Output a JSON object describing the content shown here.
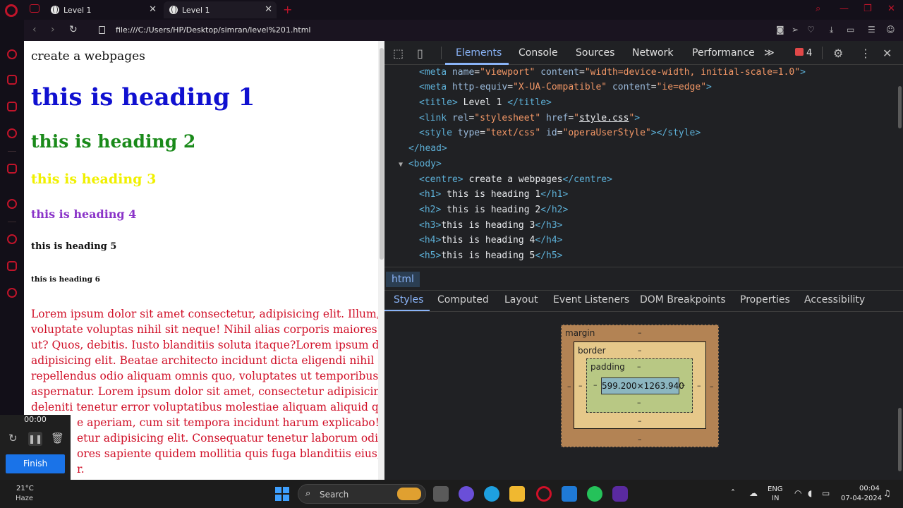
{
  "browser": {
    "tabs": [
      {
        "title": "Level 1",
        "active": false
      },
      {
        "title": "Level 1",
        "active": true
      }
    ],
    "url": "file:///C:/Users/HP/Desktop/simran/level%201.html"
  },
  "page": {
    "centre": "create a webpages",
    "h1": "this is heading 1",
    "h2": "this is heading 2",
    "h3": "this is heading 3",
    "h4": "this is heading 4",
    "h5": "this is heading 5",
    "h6": "this is heading 6",
    "lorem_lines": [
      "Lorem ipsum dolor sit amet consectetur, adipisicing elit. Illum, c",
      "voluptate voluptas nihil sit neque! Nihil alias corporis maiores v",
      "ut? Quos, debitis. Iusto blanditiis soluta itaque?Lorem ipsum dol",
      "adipisicing elit. Beatae architecto incidunt dicta eligendi nihil eo",
      "repellendus odio aliquam omnis quo, voluptates ut temporibus n",
      "aspernatur. Lorem ipsum dolor sit amet, consectetur adipisicing",
      "deleniti tenetur error voluptatibus molestiae aliquam aliquid qui",
      "e aperiam, cum sit tempora incidunt harum explicabo! Lo",
      "etur adipisicing elit. Consequatur tenetur laborum odio n",
      "ores sapiente quidem mollitia quis fuga blanditiis eius, of",
      "r."
    ]
  },
  "recorder": {
    "time": "00:00",
    "finish_label": "Finish"
  },
  "devtools": {
    "tabs": [
      "Elements",
      "Console",
      "Sources",
      "Network",
      "Performance"
    ],
    "more": "≫",
    "issues_count": "4",
    "dom": {
      "meta_viewport": {
        "tag": "meta",
        "attr1": "name",
        "val1": "\"viewport\"",
        "attr2": "content",
        "val2": "\"width=device-width, initial-scale=1.0\""
      },
      "meta_compat": {
        "tag": "meta",
        "attr1": "http-equiv",
        "val1": "\"X-UA-Compatible\"",
        "attr2": "content",
        "val2": "\"ie=edge\""
      },
      "title_open": "<title>",
      "title_text": " Level 1 ",
      "title_close": "</title>",
      "link": {
        "tag": "link",
        "attr1": "rel",
        "val1": "\"stylesheet\"",
        "attr2": "href",
        "val2": "style.css"
      },
      "style": {
        "tag": "style",
        "attr1": "type",
        "val1": "\"text/css\"",
        "attr2": "id",
        "val2": "\"operaUserStyle\""
      },
      "head_close": "</head>",
      "body_open": "<body>",
      "centre": {
        "open": "<centre>",
        "text": " create a webpages",
        "close": "</centre>"
      },
      "h1": {
        "open": "<h1>",
        "text": " this is heading 1",
        "close": "</h1>"
      },
      "h2": {
        "open": "<h2>",
        "text": " this is heading 2",
        "close": "</h2>"
      },
      "h3": {
        "open": "<h3>",
        "text": "this is heading 3",
        "close": "</h3>"
      },
      "h4": {
        "open": "<h4>",
        "text": "this is heading 4",
        "close": "</h4>"
      },
      "h5": {
        "open": "<h5>",
        "text": "this is heading 5",
        "close": "</h5>"
      }
    },
    "breadcrumb": "html",
    "subtabs": [
      "Styles",
      "Computed",
      "Layout",
      "Event Listeners",
      "DOM Breakpoints",
      "Properties",
      "Accessibility"
    ],
    "boxmodel": {
      "margin_label": "margin",
      "border_label": "border",
      "padding_label": "padding",
      "dash": "–",
      "content": "599.200×1263.940"
    }
  },
  "taskbar": {
    "temperature": "21°C",
    "weather": "Haze",
    "search_label": "Search",
    "lang_top": "ENG",
    "lang_bottom": "IN",
    "time": "00:04",
    "date": "07-04-2024"
  }
}
